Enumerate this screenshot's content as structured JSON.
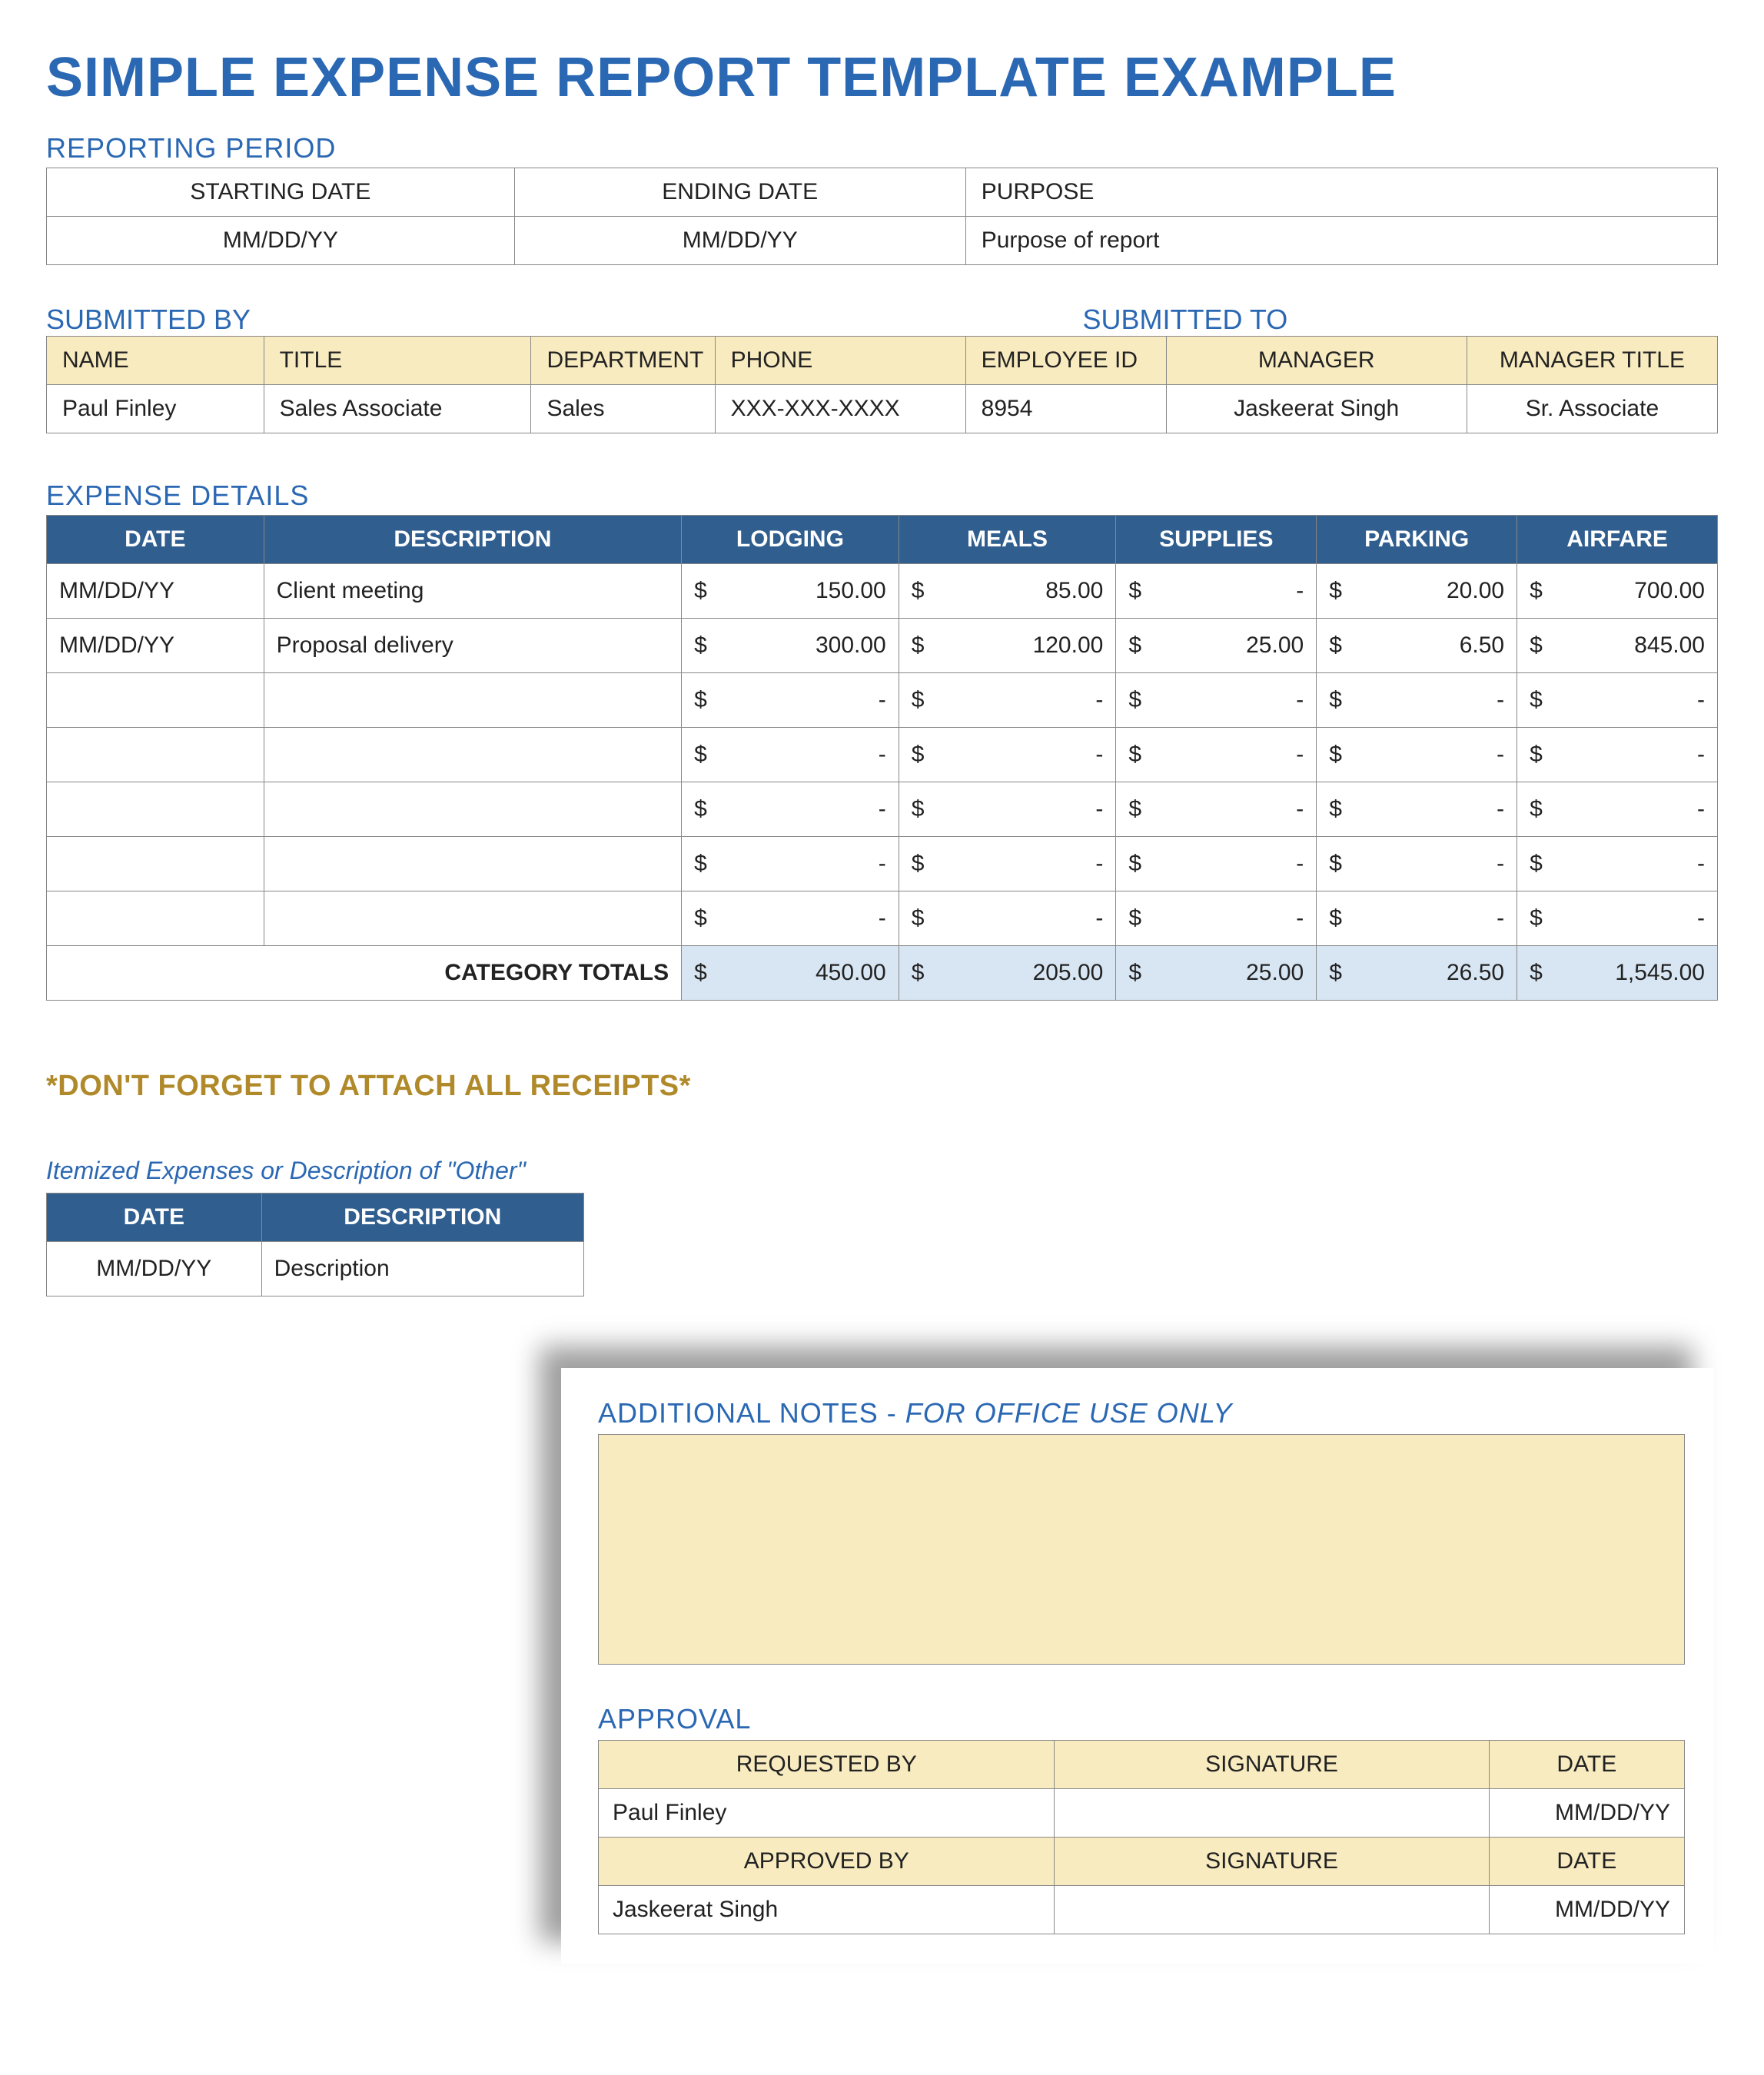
{
  "title": "SIMPLE EXPENSE REPORT TEMPLATE EXAMPLE",
  "reporting": {
    "label": "REPORTING PERIOD",
    "headers": {
      "start": "STARTING DATE",
      "end": "ENDING DATE",
      "purpose": "PURPOSE"
    },
    "values": {
      "start": "MM/DD/YY",
      "end": "MM/DD/YY",
      "purpose": "Purpose of report"
    }
  },
  "submitted": {
    "by_label": "SUBMITTED BY",
    "to_label": "SUBMITTED TO",
    "headers": {
      "name": "NAME",
      "title": "TITLE",
      "department": "DEPARTMENT",
      "phone": "PHONE",
      "employee_id": "EMPLOYEE ID",
      "manager": "MANAGER",
      "manager_title": "MANAGER TITLE"
    },
    "row": {
      "name": "Paul Finley",
      "title": "Sales Associate",
      "department": "Sales",
      "phone": "XXX-XXX-XXXX",
      "employee_id": "8954",
      "manager": "Jaskeerat Singh",
      "manager_title": "Sr. Associate"
    }
  },
  "expense": {
    "label": "EXPENSE DETAILS",
    "headers": {
      "date": "DATE",
      "description": "DESCRIPTION",
      "lodging": "LODGING",
      "meals": "MEALS",
      "supplies": "SUPPLIES",
      "parking": "PARKING",
      "airfare": "AIRFARE"
    },
    "currency": "$",
    "empty": "-",
    "rows": [
      {
        "date": "MM/DD/YY",
        "description": "Client meeting",
        "lodging": "150.00",
        "meals": "85.00",
        "supplies": "-",
        "parking": "20.00",
        "airfare": "700.00"
      },
      {
        "date": "MM/DD/YY",
        "description": "Proposal delivery",
        "lodging": "300.00",
        "meals": "120.00",
        "supplies": "25.00",
        "parking": "6.50",
        "airfare": "845.00"
      },
      {
        "date": "",
        "description": "",
        "lodging": "-",
        "meals": "-",
        "supplies": "-",
        "parking": "-",
        "airfare": "-"
      },
      {
        "date": "",
        "description": "",
        "lodging": "-",
        "meals": "-",
        "supplies": "-",
        "parking": "-",
        "airfare": "-"
      },
      {
        "date": "",
        "description": "",
        "lodging": "-",
        "meals": "-",
        "supplies": "-",
        "parking": "-",
        "airfare": "-"
      },
      {
        "date": "",
        "description": "",
        "lodging": "-",
        "meals": "-",
        "supplies": "-",
        "parking": "-",
        "airfare": "-"
      },
      {
        "date": "",
        "description": "",
        "lodging": "-",
        "meals": "-",
        "supplies": "-",
        "parking": "-",
        "airfare": "-"
      }
    ],
    "totals_label": "CATEGORY TOTALS",
    "totals": {
      "lodging": "450.00",
      "meals": "205.00",
      "supplies": "25.00",
      "parking": "26.50",
      "airfare": "1,545.00"
    }
  },
  "reminder": "*DON'T FORGET TO ATTACH ALL RECEIPTS*",
  "itemized": {
    "caption_full": "Itemized Expenses or Description of \"Other\"",
    "headers": {
      "date": "DATE",
      "description": "DESCRIPTION"
    },
    "row": {
      "date": "MM/DD/YY",
      "description": "Description"
    }
  },
  "overlay": {
    "notes_label": "ADDITIONAL NOTES - ",
    "notes_label_ital": "FOR OFFICE USE ONLY",
    "approval_label": "APPROVAL",
    "headers": {
      "requested_by": "REQUESTED BY",
      "approved_by": "APPROVED BY",
      "signature": "SIGNATURE",
      "date": "DATE"
    },
    "requested": {
      "name": "Paul Finley",
      "date": "MM/DD/YY"
    },
    "approved": {
      "name": "Jaskeerat Singh",
      "date": "MM/DD/YY"
    }
  }
}
